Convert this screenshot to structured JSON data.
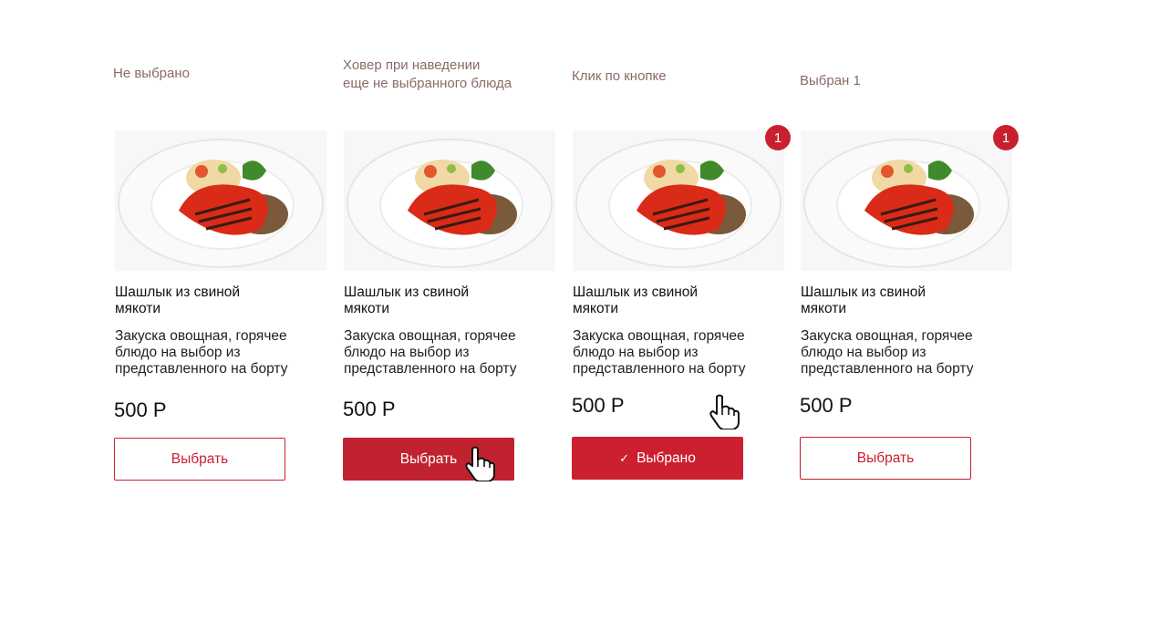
{
  "states": [
    {
      "label": "Не выбрано"
    },
    {
      "label": "Ховер при наведении\nеще не выбранного блюда"
    },
    {
      "label": "Клик по кнопке"
    },
    {
      "label": "Выбран 1"
    }
  ],
  "cards": [
    {
      "title": "Шашлык из свиной\nмякоти",
      "description": "Закуска овощная, горячее блюдо на выбор из представленного на борту",
      "price": "500 Р",
      "button_label": "Выбрать",
      "badge": ""
    },
    {
      "title": "Шашлык из свиной\nмякоти",
      "description": "Закуска овощная, горячее блюдо на выбор из представленного на борту",
      "price": "500 Р",
      "button_label": "Выбрать",
      "badge": ""
    },
    {
      "title": "Шашлык из свиной\nмякоти",
      "description": "Закуска овощная, горячее блюдо на выбор из представленного на борту",
      "price": "500 Р",
      "button_label": "Выбрано",
      "badge": "1"
    },
    {
      "title": "Шашлык из свиной\nмякоти",
      "description": "Закуска овощная, горячее блюдо на выбор из представленного на борту",
      "price": "500 Р",
      "button_label": "Выбрать",
      "badge": "1"
    }
  ],
  "icons": {
    "check": "✓",
    "cursor": "hand-pointer-icon",
    "photo": "dish-photo"
  },
  "colors": {
    "accent": "#c8202e",
    "label": "#8b6a66"
  }
}
